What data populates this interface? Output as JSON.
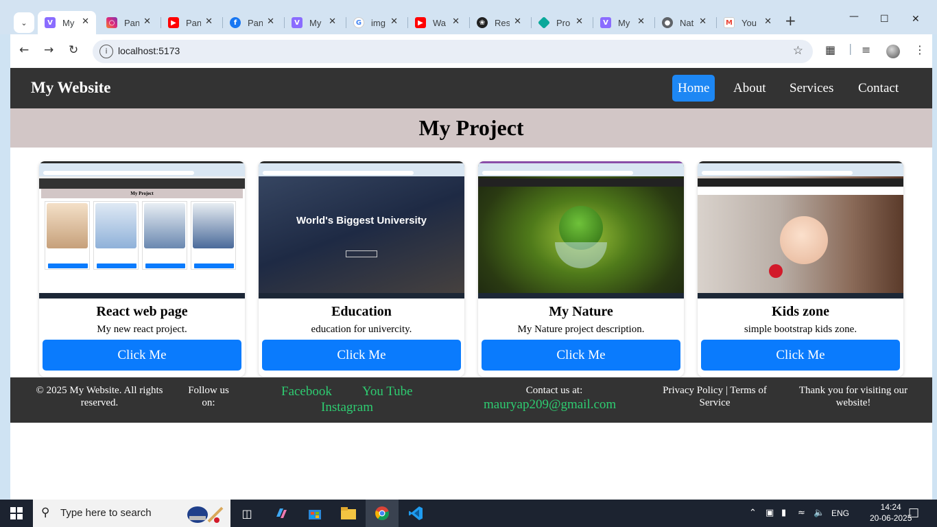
{
  "browser": {
    "tabs": [
      {
        "title": "My",
        "icon": "vite-icon",
        "color": "#8a6cff",
        "active": true
      },
      {
        "title": "Pan",
        "icon": "instagram-icon",
        "color": "#d6249f"
      },
      {
        "title": "Pan",
        "icon": "youtube-icon",
        "color": "#ff0000"
      },
      {
        "title": "Pan",
        "icon": "facebook-icon",
        "color": "#1877f2"
      },
      {
        "title": "My",
        "icon": "vite-icon",
        "color": "#8a6cff"
      },
      {
        "title": "img",
        "icon": "google-icon",
        "color": "#4285f4"
      },
      {
        "title": "Wa",
        "icon": "youtube-icon",
        "color": "#ff0000"
      },
      {
        "title": "Res",
        "icon": "openai-icon",
        "color": "#222222"
      },
      {
        "title": "Pro",
        "icon": "diamond-icon",
        "color": "#0aa89a"
      },
      {
        "title": "My",
        "icon": "vite-icon",
        "color": "#8a6cff"
      },
      {
        "title": "Nat",
        "icon": "globe-icon",
        "color": "#5f6368"
      },
      {
        "title": "You",
        "icon": "gmail-icon",
        "color": "#ea4335"
      }
    ],
    "url": "localhost:5173"
  },
  "site": {
    "brand": "My Website",
    "nav": [
      "Home",
      "About",
      "Services",
      "Contact"
    ],
    "active_nav": "Home",
    "heading": "My Project",
    "cards": [
      {
        "title": "React web page",
        "text": "My new react project.",
        "button": "Click Me"
      },
      {
        "title": "Education",
        "text": "education for univercity.",
        "button": "Click Me"
      },
      {
        "title": "My Nature",
        "text": "My Nature project description.",
        "button": "Click Me"
      },
      {
        "title": "Kids zone",
        "text": "simple bootstrap kids zone.",
        "button": "Click Me"
      }
    ],
    "card_thumbs": {
      "react_header": "My Project",
      "education_banner": "World's Biggest University"
    },
    "footer": {
      "copyright_line1": "© 2025 My Website. All rights",
      "copyright_line2": "reserved.",
      "follow_line1": "Follow us",
      "follow_line2": "on:",
      "links": [
        "Facebook",
        "You Tube",
        "Instagram"
      ],
      "contact_label": "Contact us at:",
      "email": "mauryap209@gmail.com",
      "policy_line1": "Privacy Policy | Terms of",
      "policy_line2": "Service",
      "thanks_line1": "Thank you for visiting our",
      "thanks_line2": "website!"
    },
    "accent_color": "#0a7bfd",
    "link_color": "#2ecc71"
  },
  "taskbar": {
    "search_placeholder": "Type here to search",
    "language": "ENG",
    "time": "14:24",
    "date": "20-06-2025"
  }
}
